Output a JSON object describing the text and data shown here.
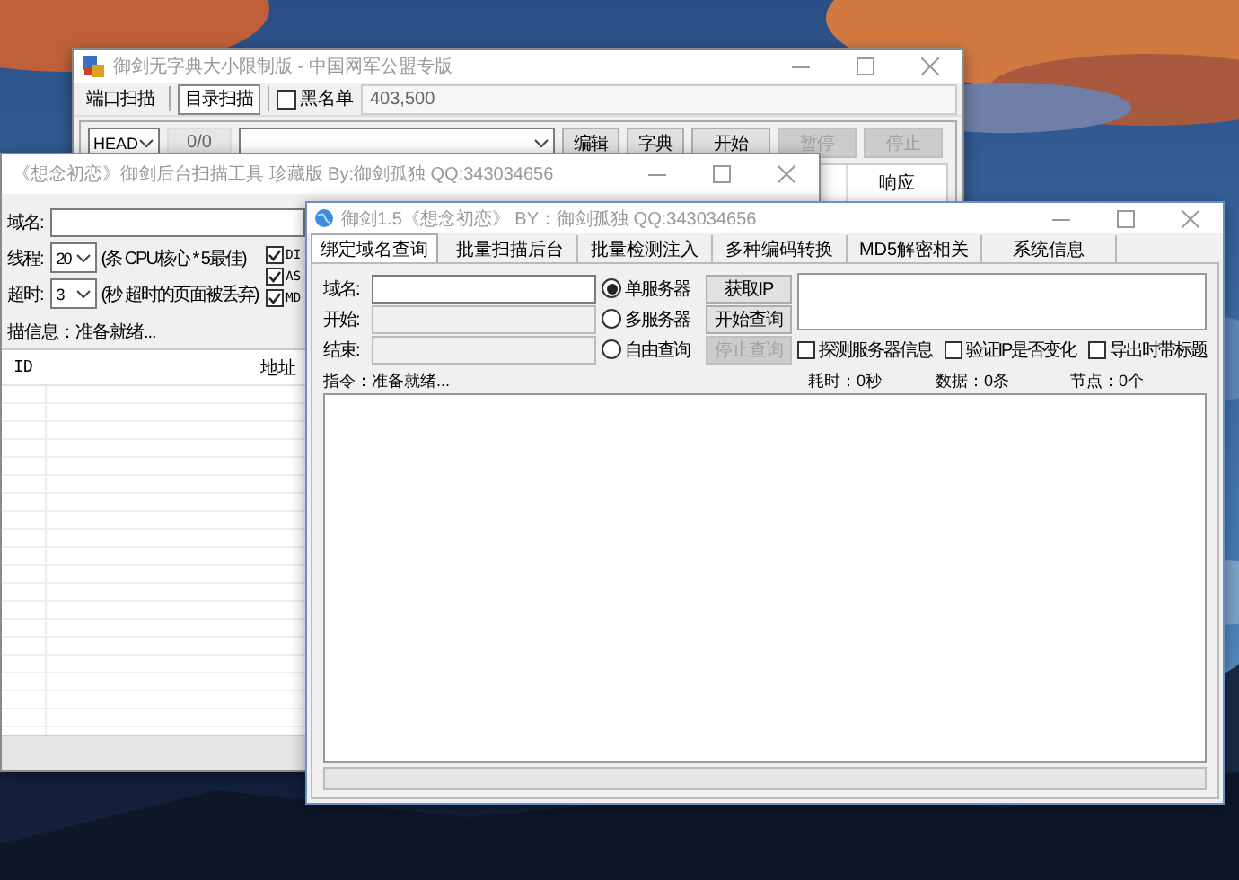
{
  "back_window": {
    "title": "御剑无字典大小限制版 - 中国网军公盟专版",
    "modes": [
      {
        "label": "端口扫描",
        "selected": false
      },
      {
        "label": "目录扫描",
        "selected": true
      }
    ],
    "blacklist": {
      "label": "黑名单",
      "checked": false,
      "value": "403,500"
    },
    "method": "HEAD",
    "counter": "0/0",
    "buttons": [
      {
        "label": "编辑",
        "disabled": false
      },
      {
        "label": "字典",
        "disabled": false
      },
      {
        "label": "开始",
        "disabled": false
      },
      {
        "label": "暂停",
        "disabled": true
      },
      {
        "label": "停止",
        "disabled": true
      }
    ],
    "column": "响应"
  },
  "middle_window": {
    "title": "《想念初恋》御剑后台扫描工具 珍藏版 By:御剑孤独 QQ:343034656",
    "domain_label": "域名:",
    "settings": [
      {
        "label": "线程:",
        "value": "20",
        "hint": "(条 CPU核心 * 5最佳)"
      },
      {
        "label": "超时:",
        "value": "3",
        "hint": "(秒 超时的页面被丢弃)"
      }
    ],
    "options": [
      {
        "label": "DI",
        "checked": true
      },
      {
        "label": "AS",
        "checked": true
      },
      {
        "label": "MD",
        "checked": true
      }
    ],
    "status": "描信息：准备就绪...",
    "columns": [
      "ID",
      "地址"
    ]
  },
  "front_window": {
    "title": "御剑1.5《想念初恋》 BY：御剑孤独 QQ:343034656",
    "tabs": [
      {
        "label": "绑定域名查询",
        "selected": true
      },
      {
        "label": "批量扫描后台",
        "selected": false
      },
      {
        "label": "批量检测注入",
        "selected": false
      },
      {
        "label": "多种编码转换",
        "selected": false
      },
      {
        "label": "MD5解密相关",
        "selected": false
      },
      {
        "label": "系统信息",
        "selected": false
      }
    ],
    "fields": [
      {
        "label": "域名:",
        "disabled": false
      },
      {
        "label": "开始:",
        "disabled": true
      },
      {
        "label": "结束:",
        "disabled": true
      }
    ],
    "modes": [
      {
        "label": "单服务器",
        "selected": true
      },
      {
        "label": "多服务器",
        "selected": false
      },
      {
        "label": "自由查询",
        "selected": false
      }
    ],
    "buttons": [
      {
        "label": "获取IP",
        "disabled": false
      },
      {
        "label": "开始查询",
        "disabled": false
      },
      {
        "label": "停止查询",
        "disabled": true
      }
    ],
    "options": [
      {
        "label": "探测服务器信息",
        "checked": false
      },
      {
        "label": "验证IP是否变化",
        "checked": false
      },
      {
        "label": "导出时带标题",
        "checked": false
      }
    ],
    "status": {
      "command": "指令：准备就绪...",
      "elapsed": "耗时：0秒",
      "records": "数据：0条",
      "nodes": "节点：0个"
    },
    "progress": {
      "level": 0
    }
  }
}
